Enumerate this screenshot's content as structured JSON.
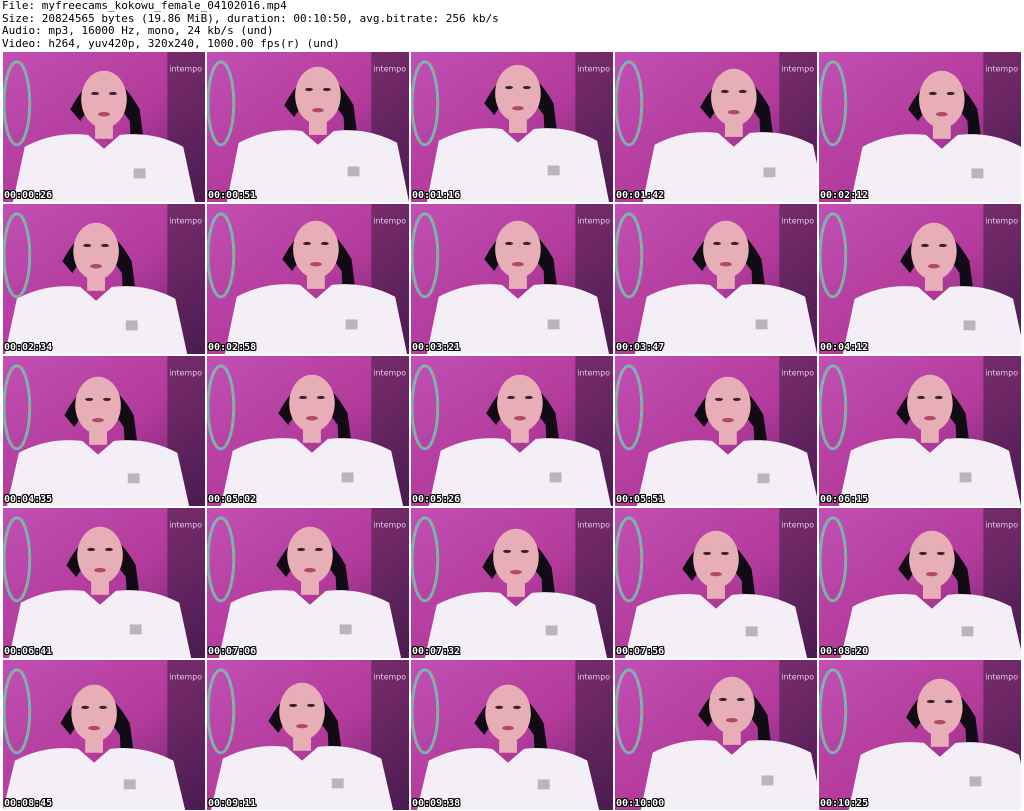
{
  "header": {
    "file_line": "File: myfreecams_kokowu_female_04102016.mp4",
    "size_line": "Size: 20824565 bytes (19.86 MiB), duration: 00:10:50, avg.bitrate: 256 kb/s",
    "audio_line": "Audio: mp3, 16000 Hz, mono, 24 kb/s (und)",
    "video_line": "Video: h264, yuv420p, 320x240, 1000.00 fps(r) (und)"
  },
  "thumbnails": [
    {
      "timestamp": "00:00:26",
      "overlay_text": "intempo"
    },
    {
      "timestamp": "00:00:51",
      "overlay_text": "intempo"
    },
    {
      "timestamp": "00:01:16",
      "overlay_text": "intempo"
    },
    {
      "timestamp": "00:01:42",
      "overlay_text": "intempo"
    },
    {
      "timestamp": "00:02:12",
      "overlay_text": "intempo"
    },
    {
      "timestamp": "00:02:34",
      "overlay_text": "intempo"
    },
    {
      "timestamp": "00:02:58",
      "overlay_text": "intempo"
    },
    {
      "timestamp": "00:03:21",
      "overlay_text": "intempo"
    },
    {
      "timestamp": "00:03:47",
      "overlay_text": "intempo"
    },
    {
      "timestamp": "00:04:12",
      "overlay_text": "intempo"
    },
    {
      "timestamp": "00:04:35",
      "overlay_text": "intempo"
    },
    {
      "timestamp": "00:05:02",
      "overlay_text": "intempo"
    },
    {
      "timestamp": "00:05:26",
      "overlay_text": "intempo"
    },
    {
      "timestamp": "00:05:51",
      "overlay_text": "intempo"
    },
    {
      "timestamp": "00:06:15",
      "overlay_text": "intempo"
    },
    {
      "timestamp": "00:06:41",
      "overlay_text": "intempo"
    },
    {
      "timestamp": "00:07:06",
      "overlay_text": "intempo"
    },
    {
      "timestamp": "00:07:32",
      "overlay_text": "intempo"
    },
    {
      "timestamp": "00:07:56",
      "overlay_text": "intempo"
    },
    {
      "timestamp": "00:08:20",
      "overlay_text": "intempo"
    },
    {
      "timestamp": "00:08:45",
      "overlay_text": "intempo"
    },
    {
      "timestamp": "00:09:11",
      "overlay_text": "intempo"
    },
    {
      "timestamp": "00:09:38",
      "overlay_text": "intempo"
    },
    {
      "timestamp": "00:10:00",
      "overlay_text": "intempo"
    },
    {
      "timestamp": "00:10:25",
      "overlay_text": "intempo"
    }
  ],
  "colors": {
    "background": "#ffffff",
    "header_text": "#000000",
    "timestamp_text": "#ffffff",
    "timestamp_outline": "#000000",
    "frame_backdrop": "#b23a9a",
    "frame_shirt": "#f4eef6",
    "frame_hair": "#120a14",
    "frame_skin": "#e7aeb8"
  }
}
